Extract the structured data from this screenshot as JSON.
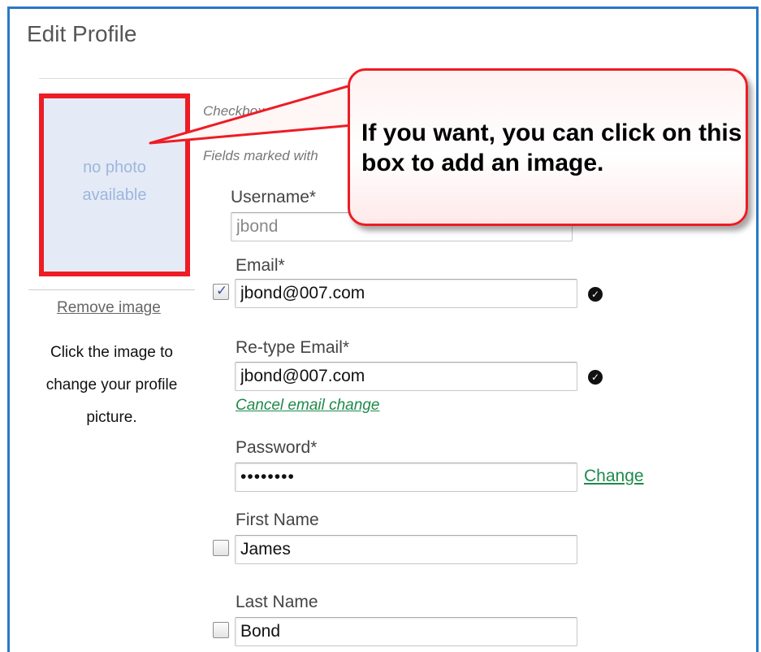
{
  "page": {
    "title": "Edit Profile",
    "intro_1": "Checkboxes to",
    "intro_2": "Fields marked with"
  },
  "photo": {
    "placeholder_line1": "no photo",
    "placeholder_line2": "available",
    "remove_label": "Remove image",
    "help_text": "Click the image to change your profile picture."
  },
  "form": {
    "username": {
      "label": "Username*",
      "value": "jbond"
    },
    "email": {
      "label": "Email*",
      "value": "jbond@007.com",
      "checked": true
    },
    "retype_email": {
      "label": "Re-type Email*",
      "value": "jbond@007.com"
    },
    "cancel_email_change": "Cancel email change",
    "password": {
      "label": "Password*",
      "value": "••••••••",
      "change_label": "Change"
    },
    "first_name": {
      "label": "First Name",
      "value": "James",
      "checked": false
    },
    "last_name": {
      "label": "Last Name",
      "value": "Bond",
      "checked": false
    }
  },
  "callout": {
    "text": "If you want, you can click on this box to add an image."
  },
  "icons": {
    "valid": "check-circle-icon",
    "checkbox_mark": "checkmark-icon"
  },
  "colors": {
    "frame_border": "#2a78c4",
    "highlight_red": "#ee1c24",
    "link_green": "#1f8a4c",
    "photo_bg": "#e4ebf7"
  }
}
